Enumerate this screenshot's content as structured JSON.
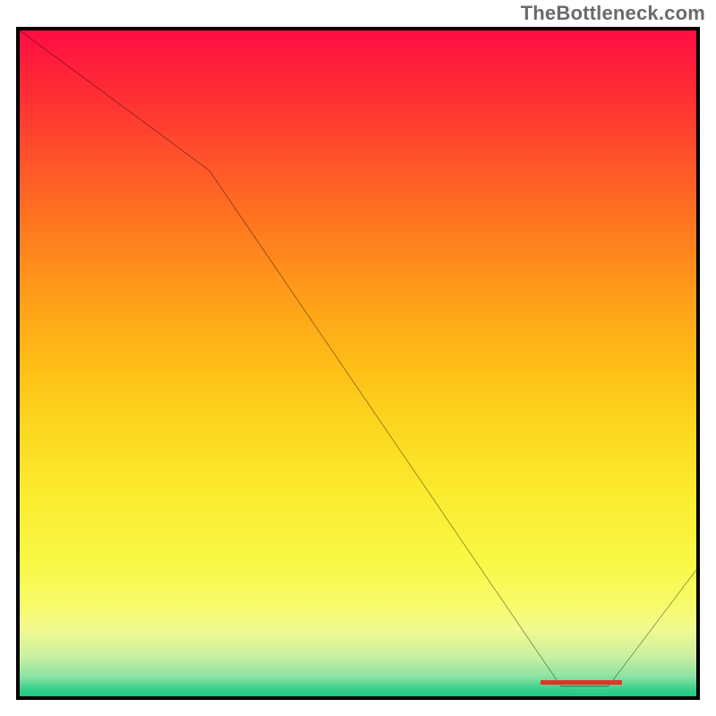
{
  "watermark": "TheBottleneck.com",
  "chart_data": {
    "type": "line",
    "title": "",
    "xlabel": "",
    "ylabel": "",
    "xlim": [
      0,
      100
    ],
    "ylim": [
      0,
      100
    ],
    "grid": false,
    "legend": false,
    "background": "gradient-red-yellow-green",
    "series": [
      {
        "name": "bottleneck-curve",
        "x": [
          0,
          28,
          80,
          87,
          100
        ],
        "values": [
          100,
          79,
          1.5,
          1.5,
          19
        ]
      }
    ],
    "flat_segment": {
      "x_start": 78,
      "x_end": 88,
      "y": 1.6
    },
    "annotations": [
      {
        "name": "red-marker-bar",
        "x_start": 77,
        "x_end": 89,
        "y": 1.7,
        "color": "#E53324"
      }
    ]
  },
  "colors": {
    "line": "#000000",
    "border": "#000000",
    "watermark": "#6a6a6a",
    "marker": "#E53324"
  }
}
